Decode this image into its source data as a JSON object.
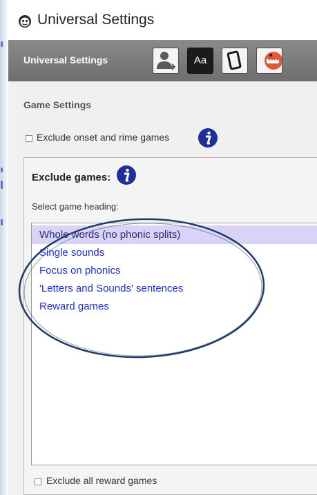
{
  "window": {
    "title": "Universal Settings",
    "app_icon": "character-face-icon"
  },
  "toolbar": {
    "label": "Universal Settings",
    "buttons": [
      {
        "name": "user-settings",
        "icon": "person-icon"
      },
      {
        "name": "font-settings",
        "icon": "font-icon",
        "text": "Aa"
      },
      {
        "name": "device-settings",
        "icon": "tablet-icon"
      },
      {
        "name": "character-settings",
        "icon": "monster-face-icon"
      }
    ]
  },
  "game_settings": {
    "title": "Game Settings",
    "exclude_onset_rime": {
      "label": "Exclude onset and rime games",
      "checked": false
    }
  },
  "exclude_games": {
    "title": "Exclude games:",
    "select_label": "Select game heading:",
    "items": [
      "Whole words (no phonic splits)",
      "Single sounds",
      "Focus on phonics",
      "'Letters and Sounds' sentences",
      "Reward games"
    ],
    "selected_index": 0,
    "exclude_all_reward": {
      "label": "Exclude all reward games",
      "checked": false
    }
  },
  "colors": {
    "link_blue": "#1d2fd8",
    "selection": "#d9d4f7",
    "info_blue": "#1e2f9a",
    "annotation_ring": "#1e3a66"
  }
}
